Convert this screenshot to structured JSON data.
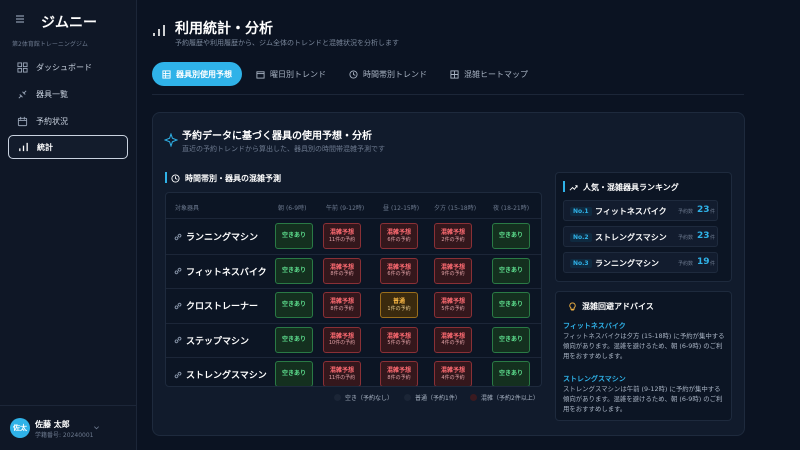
{
  "app": {
    "title": "ジムニー",
    "subtitle": "第2体育館トレーニングジム"
  },
  "nav": [
    {
      "label": "ダッシュボード",
      "icon": "dashboard-icon"
    },
    {
      "label": "器具一覧",
      "icon": "equipment-icon"
    },
    {
      "label": "予約状況",
      "icon": "calendar-icon"
    },
    {
      "label": "統計",
      "icon": "chart-icon",
      "active": true
    }
  ],
  "user": {
    "avatar": "佐太",
    "name": "佐藤 太郎",
    "id": "学籍番号: 20240001"
  },
  "header": {
    "title": "利用統計・分析",
    "subtitle": "予約履歴や利用履歴から、ジム全体のトレンドと混雑状況を分析します"
  },
  "tabs": [
    {
      "label": "器具別使用予想",
      "icon": "grid-icon",
      "active": true
    },
    {
      "label": "曜日別トレンド",
      "icon": "calendar-icon"
    },
    {
      "label": "時間帯別トレンド",
      "icon": "clock-icon"
    },
    {
      "label": "混雑ヒートマップ",
      "icon": "heatmap-icon"
    }
  ],
  "card": {
    "title": "予約データに基づく器具の使用予想・分析",
    "subtitle": "直近の予約トレンドから算出した、器具別の時間帯混雑予測です"
  },
  "forecast": {
    "title": "時間帯別・器具の混雑予測",
    "col_equipment": "対象器具",
    "slots": [
      {
        "name": "朝",
        "range": "(6-9時)"
      },
      {
        "name": "午前",
        "range": "(9-12時)"
      },
      {
        "name": "昼",
        "range": "(12-15時)"
      },
      {
        "name": "夕方",
        "range": "(15-18時)"
      },
      {
        "name": "夜",
        "range": "(18-21時)"
      }
    ],
    "rows": [
      {
        "name": "ランニングマシン",
        "cells": [
          {
            "status": "free",
            "label": "空きあり",
            "detail": ""
          },
          {
            "status": "busy",
            "label": "混雑予想",
            "detail": "11件の予約"
          },
          {
            "status": "busy",
            "label": "混雑予想",
            "detail": "6件の予約"
          },
          {
            "status": "busy",
            "label": "混雑予想",
            "detail": "2件の予約"
          },
          {
            "status": "free",
            "label": "空きあり",
            "detail": ""
          }
        ]
      },
      {
        "name": "フィットネスバイク",
        "cells": [
          {
            "status": "free",
            "label": "空きあり",
            "detail": ""
          },
          {
            "status": "busy",
            "label": "混雑予想",
            "detail": "8件の予約"
          },
          {
            "status": "busy",
            "label": "混雑予想",
            "detail": "6件の予約"
          },
          {
            "status": "busy",
            "label": "混雑予想",
            "detail": "9件の予約"
          },
          {
            "status": "free",
            "label": "空きあり",
            "detail": ""
          }
        ]
      },
      {
        "name": "クロストレーナー",
        "cells": [
          {
            "status": "free",
            "label": "空きあり",
            "detail": ""
          },
          {
            "status": "busy",
            "label": "混雑予想",
            "detail": "8件の予約"
          },
          {
            "status": "normal",
            "label": "普通",
            "detail": "1件の予約"
          },
          {
            "status": "busy",
            "label": "混雑予想",
            "detail": "5件の予約"
          },
          {
            "status": "free",
            "label": "空きあり",
            "detail": ""
          }
        ]
      },
      {
        "name": "ステップマシン",
        "cells": [
          {
            "status": "free",
            "label": "空きあり",
            "detail": ""
          },
          {
            "status": "busy",
            "label": "混雑予想",
            "detail": "10件の予約"
          },
          {
            "status": "busy",
            "label": "混雑予想",
            "detail": "5件の予約"
          },
          {
            "status": "busy",
            "label": "混雑予想",
            "detail": "4件の予約"
          },
          {
            "status": "free",
            "label": "空きあり",
            "detail": ""
          }
        ]
      },
      {
        "name": "ストレングスマシン",
        "cells": [
          {
            "status": "free",
            "label": "空きあり",
            "detail": ""
          },
          {
            "status": "busy",
            "label": "混雑予想",
            "detail": "11件の予約"
          },
          {
            "status": "busy",
            "label": "混雑予想",
            "detail": "8件の予約"
          },
          {
            "status": "busy",
            "label": "混雑予想",
            "detail": "4件の予約"
          },
          {
            "status": "free",
            "label": "空きあり",
            "detail": ""
          }
        ]
      }
    ],
    "legend": [
      {
        "label": "空き（予約なし）",
        "color": "#1b2536"
      },
      {
        "label": "普通（予約1件）",
        "color": "#1b2536"
      },
      {
        "label": "混雑（予約2件以上）",
        "color": "#3a1a20"
      }
    ]
  },
  "ranking": {
    "title": "人気・混雑器具ランキング",
    "items": [
      {
        "rank": "No.1",
        "name": "フィットネスバイク",
        "label": "予約数",
        "count": "23",
        "unit": "件"
      },
      {
        "rank": "No.2",
        "name": "ストレングスマシン",
        "label": "予約数",
        "count": "23",
        "unit": "件"
      },
      {
        "rank": "No.3",
        "name": "ランニングマシン",
        "label": "予約数",
        "count": "19",
        "unit": "件"
      }
    ]
  },
  "advice": {
    "title": "混雑回避アドバイス",
    "items": [
      {
        "name": "フィットネスバイク",
        "text": "フィットネスバイクは夕方 (15-18時) に予約が集中する傾向があります。混雑を避けるため、朝 (6-9時) のご利用をおすすめします。"
      },
      {
        "name": "ストレングスマシン",
        "text": "ストレングスマシンは午前 (9-12時) に予約が集中する傾向があります。混雑を避けるため、朝 (6-9時) のご利用をおすすめします。"
      }
    ]
  },
  "colors": {
    "accent": "#2fb2e8",
    "busy": "#ff6b72",
    "free": "#5ee08f",
    "normal": "#f5b443"
  }
}
